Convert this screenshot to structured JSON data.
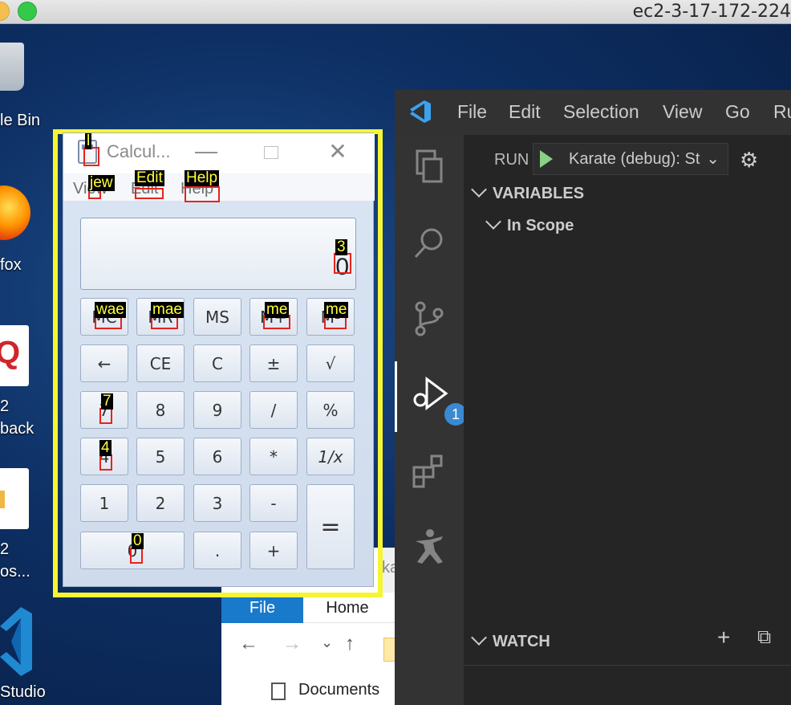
{
  "mac_window": {
    "title": "ec2-3-17-172-224"
  },
  "desktop": {
    "icons": [
      {
        "label": "le Bin"
      },
      {
        "label": "fox"
      },
      {
        "label_line1": "2",
        "label_line2": "back"
      },
      {
        "label_line1": "2",
        "label_line2": "os..."
      },
      {
        "label": "Studio"
      }
    ]
  },
  "explorer": {
    "partial_title": "ka",
    "tabs": [
      "File",
      "Home"
    ],
    "nav": {
      "back": "←",
      "forward": "→",
      "recent": "⌄",
      "up": "↑"
    },
    "item": "Documents"
  },
  "vscode": {
    "menu": [
      "File",
      "Edit",
      "Selection",
      "View",
      "Go",
      "Ru"
    ],
    "run_label": "RUN",
    "run_config": "Karate (debug): St",
    "debug_badge": "1",
    "sections": {
      "variables": "VARIABLES",
      "in_scope": "In Scope",
      "watch": "WATCH"
    },
    "watch_tools": {
      "add": "+",
      "collapse": "⧉"
    }
  },
  "calculator": {
    "title": "Calcul...",
    "window_buttons": {
      "minimize": "—",
      "close": "✕"
    },
    "menu": [
      "View",
      "Edit",
      "Help"
    ],
    "display": "0",
    "memory_buttons": [
      "MC",
      "MR",
      "MS",
      "M+",
      "M-"
    ],
    "rows": [
      [
        "←",
        "CE",
        "C",
        "±",
        "√"
      ],
      [
        "7",
        "8",
        "9",
        "/",
        "%"
      ],
      [
        "4",
        "5",
        "6",
        "*",
        "1/x"
      ],
      [
        "1",
        "2",
        "3",
        "-",
        "="
      ],
      [
        "0",
        ".",
        "+"
      ]
    ]
  },
  "annotations": {
    "title_tag": "l",
    "menu_tags": [
      "jew",
      "Edit",
      "Help"
    ],
    "display_tag": "3",
    "memory_tags": [
      "wae",
      "mae",
      "me",
      "me"
    ],
    "key_tags": [
      "7",
      "4",
      "0"
    ]
  },
  "colors": {
    "highlight": "#f5f532",
    "annotation_box": "#e8221c",
    "annotation_text": "#ffff3c",
    "vscode_bg": "#1e1e1e",
    "explorer_tab": "#1979ca"
  }
}
